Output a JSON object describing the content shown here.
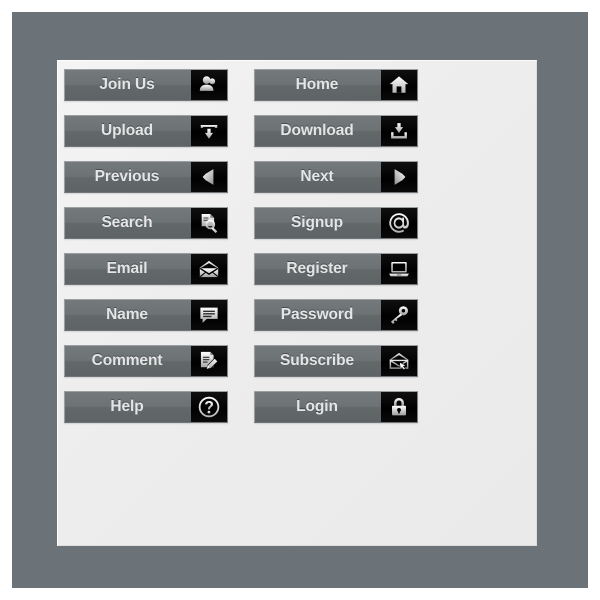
{
  "palette": {
    "mat": "#6b7378",
    "panel": "#efefef",
    "button_face": "#696f71",
    "button_text": "#e3e5e6",
    "icon_box": "#000000",
    "icon_glyph": "#ffffff",
    "page_background": "#ffffff"
  },
  "panel": {
    "title": "",
    "columns": 2,
    "rows": 8
  },
  "buttons": {
    "left_column": [
      {
        "label": "Join Us",
        "icon": "users-icon"
      },
      {
        "label": "Upload",
        "icon": "upload-tray-icon"
      },
      {
        "label": "Previous",
        "icon": "arrow-left-icon"
      },
      {
        "label": "Search",
        "icon": "document-magnifier-icon"
      },
      {
        "label": "Email",
        "icon": "envelope-open-icon"
      },
      {
        "label": "Name",
        "icon": "speech-bubble-icon"
      },
      {
        "label": "Comment",
        "icon": "document-pencil-icon"
      },
      {
        "label": "Help",
        "icon": "question-circle-icon"
      }
    ],
    "right_column": [
      {
        "label": "Home",
        "icon": "house-icon"
      },
      {
        "label": "Download",
        "icon": "download-tray-icon"
      },
      {
        "label": "Next",
        "icon": "arrow-right-icon"
      },
      {
        "label": "Signup",
        "icon": "at-sign-icon"
      },
      {
        "label": "Register",
        "icon": "laptop-icon"
      },
      {
        "label": "Password",
        "icon": "key-icon"
      },
      {
        "label": "Subscribe",
        "icon": "envelope-cursor-icon"
      },
      {
        "label": "Login",
        "icon": "padlock-icon"
      }
    ]
  }
}
